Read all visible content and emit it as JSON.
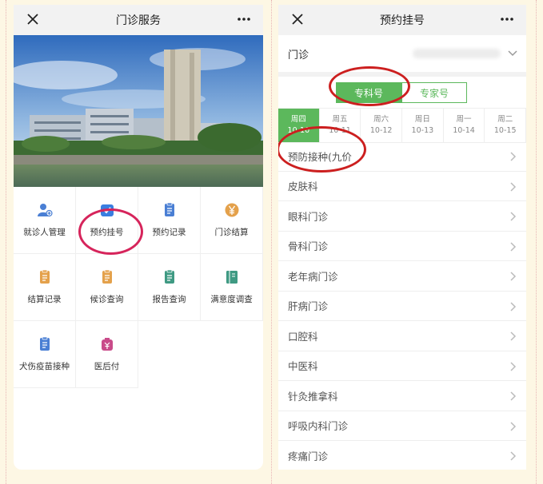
{
  "left": {
    "title": "门诊服务",
    "menu": [
      {
        "label": "就诊人管理",
        "icon": "user-add-icon",
        "color": "#4a7fd4"
      },
      {
        "label": "预约挂号",
        "icon": "calendar-check-icon",
        "color": "#3a7ee0"
      },
      {
        "label": "预约记录",
        "icon": "clipboard-list-icon",
        "color": "#4a7fd4"
      },
      {
        "label": "门诊结算",
        "icon": "yen-coin-icon",
        "color": "#e4a14b"
      },
      {
        "label": "结算记录",
        "icon": "notebook-icon",
        "color": "#e4a14b"
      },
      {
        "label": "候诊查询",
        "icon": "queue-icon",
        "color": "#e4a14b"
      },
      {
        "label": "报告查询",
        "icon": "report-icon",
        "color": "#3f9a83"
      },
      {
        "label": "满意度调查",
        "icon": "survey-book-icon",
        "color": "#3f9a83"
      },
      {
        "label": "犬伤疫苗接种",
        "icon": "vaccine-clipboard-icon",
        "color": "#4a7fd4"
      },
      {
        "label": "医后付",
        "icon": "yen-bag-icon",
        "color": "#c94b8a"
      }
    ]
  },
  "right": {
    "title": "预约挂号",
    "select": {
      "label": "门诊"
    },
    "tabs": [
      "专科号",
      "专家号"
    ],
    "days": [
      {
        "weekday": "周四",
        "date": "10-10",
        "active": true
      },
      {
        "weekday": "周五",
        "date": "10-11",
        "active": false
      },
      {
        "weekday": "周六",
        "date": "10-12",
        "active": false
      },
      {
        "weekday": "周日",
        "date": "10-13",
        "active": false
      },
      {
        "weekday": "周一",
        "date": "10-14",
        "active": false
      },
      {
        "weekday": "周二",
        "date": "10-15",
        "active": false
      }
    ],
    "departments": [
      "预防接种(九价",
      "皮肤科",
      "眼科门诊",
      "骨科门诊",
      "老年病门诊",
      "肝病门诊",
      "口腔科",
      "中医科",
      "针灸推拿科",
      "呼吸内科门诊",
      "疼痛门诊"
    ]
  },
  "colors": {
    "accent": "#5cb85c",
    "highlight_ring": "#d6245b"
  }
}
